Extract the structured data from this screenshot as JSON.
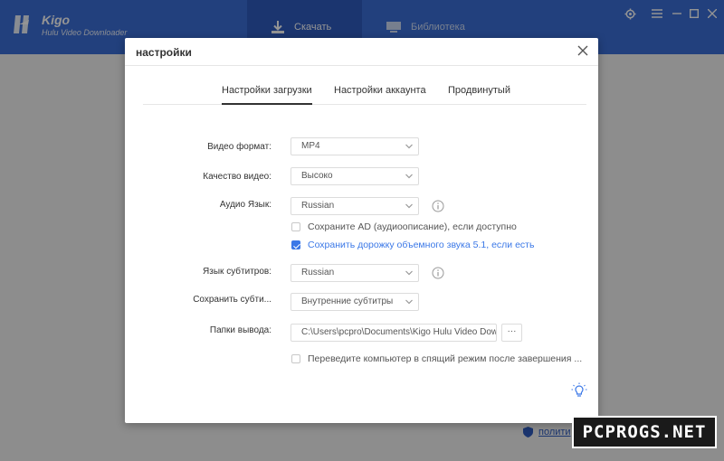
{
  "app": {
    "brand_name": "Kigo",
    "brand_sub": "Hulu Video Downloader",
    "nav": [
      {
        "label": "Скачать",
        "icon": "download-icon"
      },
      {
        "label": "Библиотека",
        "icon": "library-icon"
      }
    ],
    "footer_link": "полити"
  },
  "dialog": {
    "title": "настройки",
    "tabs": [
      {
        "label": "Настройки загрузки",
        "active": true
      },
      {
        "label": "Настройки аккаунта",
        "active": false
      },
      {
        "label": "Продвинутый",
        "active": false
      }
    ],
    "fields": {
      "video_format": {
        "label": "Видео формат:",
        "value": "MP4"
      },
      "video_quality": {
        "label": "Качество видео:",
        "value": "Высоко"
      },
      "audio_language": {
        "label": "Аудио Язык:",
        "value": "Russian"
      },
      "subtitle_language": {
        "label": "Язык субтитров:",
        "value": "Russian"
      },
      "save_subtitles": {
        "label": "Сохранить субти...",
        "value": "Внутренние субтитры"
      },
      "output_folder": {
        "label": "Папки вывода:",
        "value": "C:\\Users\\pcpro\\Documents\\Kigo Hulu Video Dow",
        "browse_label": "···"
      }
    },
    "checkboxes": {
      "save_ad": {
        "label": "Сохраните AD (аудиоописание), если доступно",
        "checked": false
      },
      "save_surround": {
        "label": "Сохранить дорожку объемного звука 5.1, если есть",
        "checked": true
      },
      "sleep_after": {
        "label": "Переведите компьютер в спящий режим после завершения ...",
        "checked": false
      }
    }
  },
  "watermark": "PCPROGS.NET",
  "colors": {
    "header_blue": "#3b6fd8",
    "active_nav": "#2f5cc0",
    "accent": "#3b78e7"
  }
}
